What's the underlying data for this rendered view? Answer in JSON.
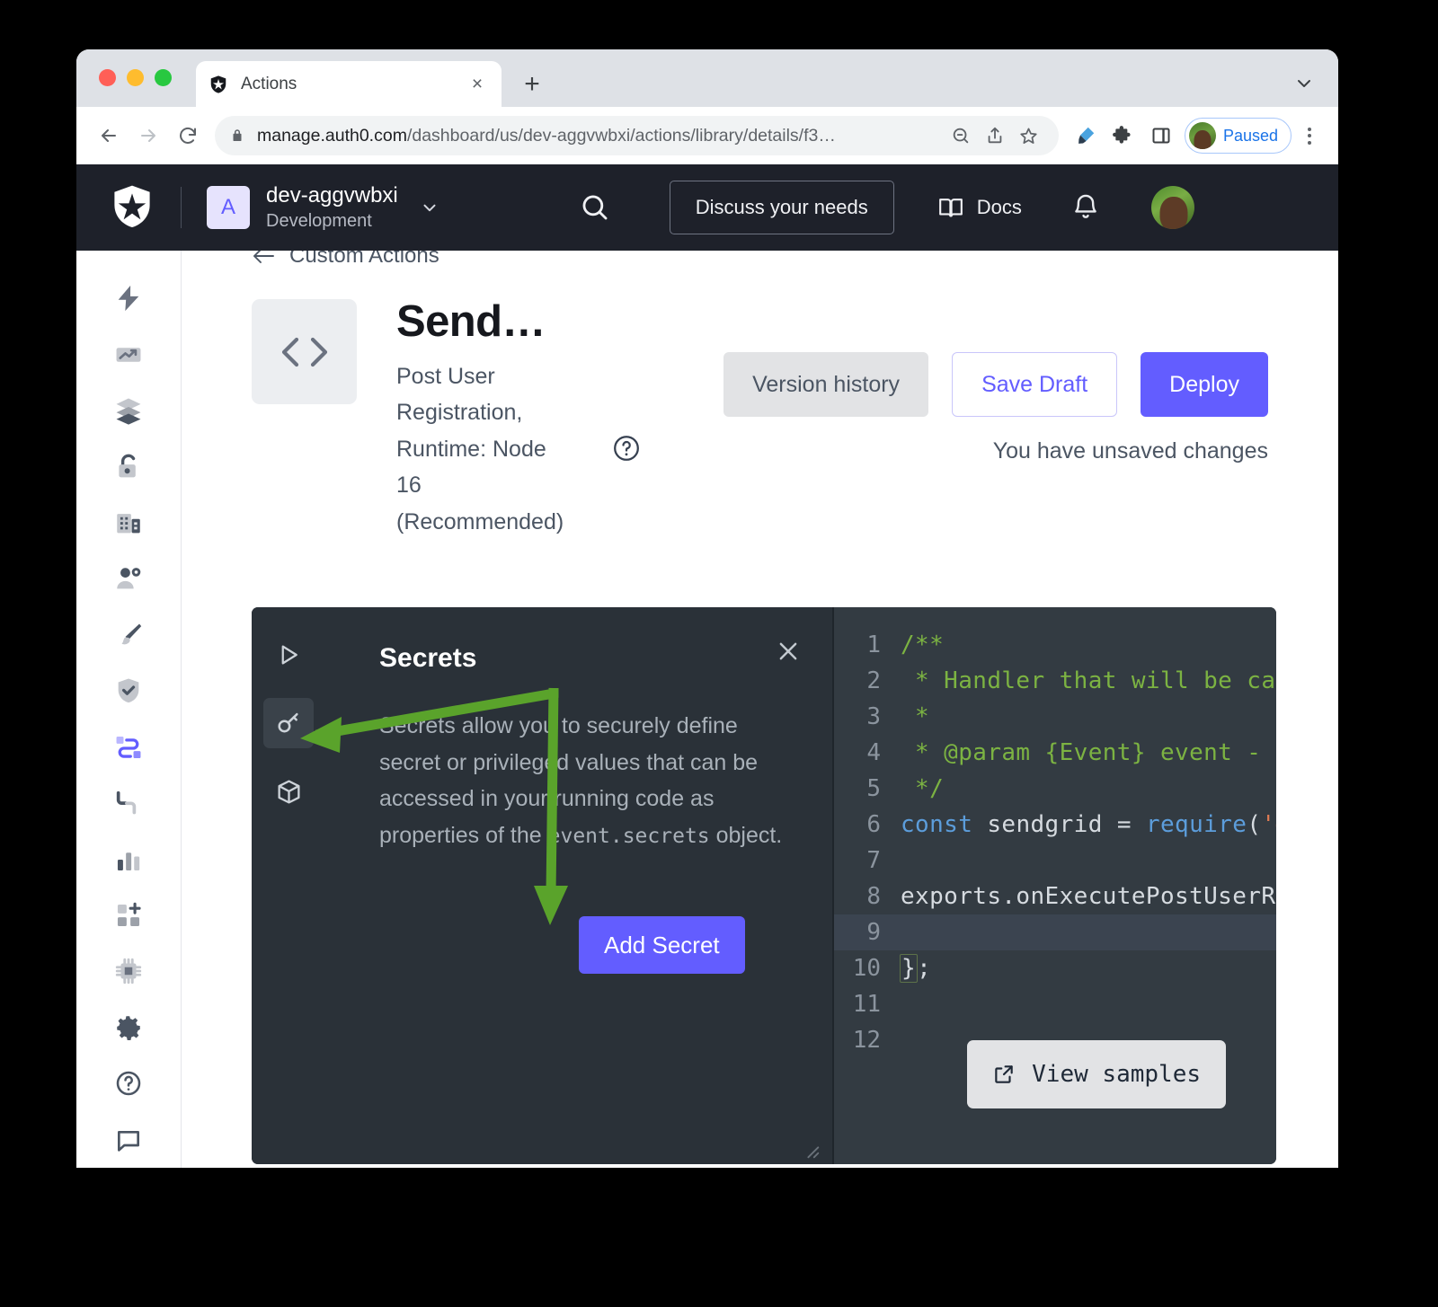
{
  "browser": {
    "tab": {
      "title": "Actions",
      "favicon": "auth0-shield-icon",
      "close": "×"
    },
    "new_tab": "+",
    "url_bold": "manage.auth0.com",
    "url_rest": "/dashboard/us/dev-aggvwbxi/actions/library/details/f3…",
    "profile_label": "Paused",
    "icons": [
      "lock-icon",
      "zoom-icon",
      "share-icon",
      "bookmark-star-icon",
      "highlighter-icon",
      "extensions-puzzle-icon",
      "side-panel-icon",
      "kebab-menu-icon"
    ]
  },
  "topnav": {
    "tenant_initial": "A",
    "tenant_name": "dev-aggvwbxi",
    "tenant_env": "Development",
    "discuss_label": "Discuss your needs",
    "docs_label": "Docs"
  },
  "sidebar": {
    "items": [
      {
        "name": "getting-started",
        "icon": "lightning-icon",
        "active": false
      },
      {
        "name": "activity",
        "icon": "trend-up-icon",
        "active": false
      },
      {
        "name": "applications",
        "icon": "layers-icon",
        "active": false
      },
      {
        "name": "authentication",
        "icon": "lock-icon",
        "active": false
      },
      {
        "name": "organizations",
        "icon": "building-icon",
        "active": false
      },
      {
        "name": "user-management",
        "icon": "user-gear-icon",
        "active": false
      },
      {
        "name": "branding",
        "icon": "paintbrush-icon",
        "active": false
      },
      {
        "name": "security",
        "icon": "shield-check-icon",
        "active": false
      },
      {
        "name": "actions",
        "icon": "flow-connector-icon",
        "active": true
      },
      {
        "name": "auth-pipeline",
        "icon": "pipeline-icon",
        "active": false
      },
      {
        "name": "monitoring",
        "icon": "bar-chart-icon",
        "active": false
      },
      {
        "name": "marketplace",
        "icon": "grid-plus-icon",
        "active": false
      },
      {
        "name": "extensions",
        "icon": "chip-icon",
        "active": false
      },
      {
        "name": "settings",
        "icon": "gear-icon",
        "active": false
      },
      {
        "name": "help",
        "icon": "question-circle-icon",
        "active": false
      },
      {
        "name": "feedback",
        "icon": "chat-square-icon",
        "active": false
      }
    ]
  },
  "page": {
    "breadcrumb": "Custom Actions",
    "title": "Send…",
    "subtitle": "Post User Registration, Runtime: Node 16 (Recommended)",
    "buttons": {
      "version_history": "Version history",
      "save_draft": "Save Draft",
      "deploy": "Deploy"
    },
    "unsaved_notice": "You have unsaved changes"
  },
  "secrets_panel": {
    "title": "Secrets",
    "description_before": "Secrets allow you to securely define secret or privileged values that can be accessed in your running code as properties of the ",
    "description_code": "event.secrets",
    "description_after": " object.",
    "add_button": "Add Secret",
    "close": "×",
    "rail": [
      {
        "name": "test-run",
        "icon": "play-icon",
        "active": false
      },
      {
        "name": "secrets",
        "icon": "key-icon",
        "active": true
      },
      {
        "name": "dependencies",
        "icon": "package-box-icon",
        "active": false
      }
    ]
  },
  "code_editor": {
    "view_samples": "View samples",
    "active_line": 9,
    "lines": [
      {
        "n": 1,
        "tokens": [
          {
            "t": "/**",
            "c": "cm"
          }
        ]
      },
      {
        "n": 2,
        "tokens": [
          {
            "t": " * Handler that will be call",
            "c": "cm"
          }
        ]
      },
      {
        "n": 3,
        "tokens": [
          {
            "t": " *",
            "c": "cm"
          }
        ]
      },
      {
        "n": 4,
        "tokens": [
          {
            "t": " * @param {Event} event - De",
            "c": "cm"
          }
        ]
      },
      {
        "n": 5,
        "tokens": [
          {
            "t": " */",
            "c": "cm"
          }
        ]
      },
      {
        "n": 6,
        "tokens": [
          {
            "t": "const",
            "c": "ck"
          },
          {
            "t": " sendgrid ",
            "c": "cp"
          },
          {
            "t": "=",
            "c": "cp"
          },
          {
            "t": " ",
            "c": "cp"
          },
          {
            "t": "require",
            "c": "ck"
          },
          {
            "t": "(",
            "c": "cp"
          },
          {
            "t": "'@s",
            "c": "cs"
          }
        ]
      },
      {
        "n": 7,
        "tokens": []
      },
      {
        "n": 8,
        "tokens": [
          {
            "t": "exports.onExecutePostUserReg",
            "c": "cp"
          }
        ]
      },
      {
        "n": 9,
        "tokens": []
      },
      {
        "n": 10,
        "tokens": [
          {
            "t": "}",
            "c": "cp brkt"
          },
          {
            "t": ";",
            "c": "cp"
          }
        ]
      },
      {
        "n": 11,
        "tokens": []
      },
      {
        "n": 12,
        "tokens": []
      }
    ]
  },
  "annotation": {
    "color": "#5aa32b",
    "arrows": [
      "arrow-to-key-icon",
      "arrow-to-add-secret-button"
    ]
  },
  "colors": {
    "brand_purple": "#635dff",
    "topnav_dark": "#1e212a",
    "panel_dark": "#2a3138",
    "editor_dark": "#333b42",
    "annotation_green": "#5aa32b"
  }
}
